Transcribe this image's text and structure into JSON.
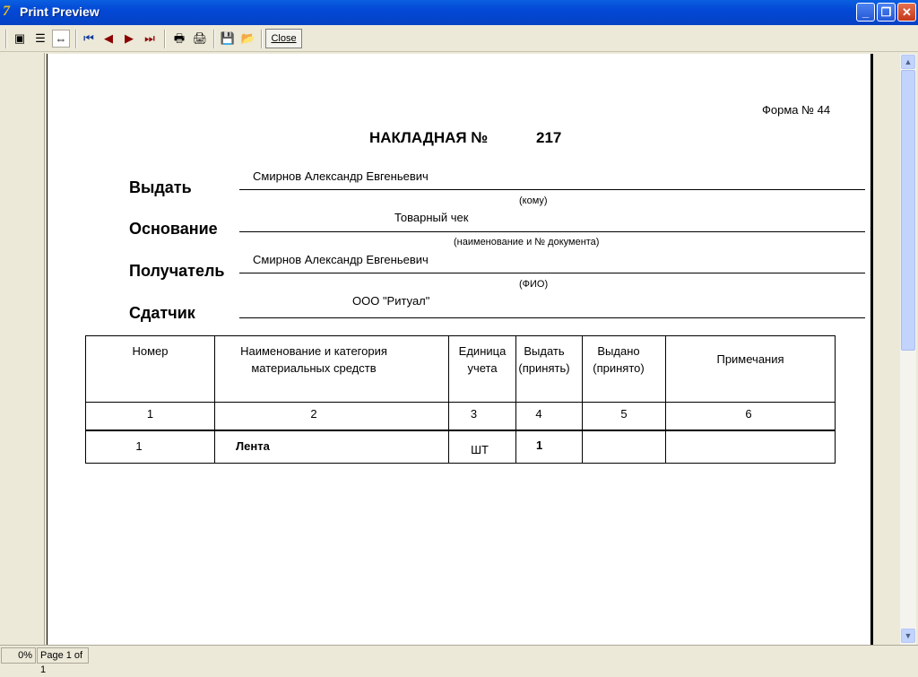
{
  "window": {
    "title": "Print Preview",
    "minimize": "_",
    "restore": "❐",
    "close": "✕"
  },
  "toolbar": {
    "close_label": "Close",
    "buttons": [
      "one-page",
      "continuous",
      "fit-width",
      "first-page",
      "prev-page",
      "next-page",
      "last-page",
      "print-setup",
      "print",
      "save",
      "open"
    ]
  },
  "status": {
    "zoom": "0%",
    "page": "Page 1 of 1"
  },
  "doc": {
    "form_no": "Форма № 44",
    "title": "НАКЛАДНАЯ  №",
    "number": "217",
    "fields": [
      {
        "label": "Выдать",
        "value": "Смирнов Александр Евгеньевич",
        "hint": "(кому)"
      },
      {
        "label": "Основание",
        "value": "Товарный чек",
        "hint": "(наименование и № документа)"
      },
      {
        "label": "Получатель",
        "value": "Смирнов Александр Евгеньевич",
        "hint": "(ФИО)"
      },
      {
        "label": "Сдатчик",
        "value": "ООО \"Ритуал\""
      }
    ],
    "table": {
      "headers": [
        [
          "Номер"
        ],
        [
          "Наименование и категория",
          "материальных средств"
        ],
        [
          "Единица",
          "учета"
        ],
        [
          "Выдать",
          "(принять)"
        ],
        [
          "Выдано",
          "(принято)"
        ],
        [
          "Примечания"
        ]
      ],
      "col_numbers": [
        "1",
        "2",
        "3",
        "4",
        "5",
        "6"
      ],
      "rows": [
        [
          "1",
          "Лента",
          "шт",
          "1",
          "",
          ""
        ]
      ]
    }
  }
}
